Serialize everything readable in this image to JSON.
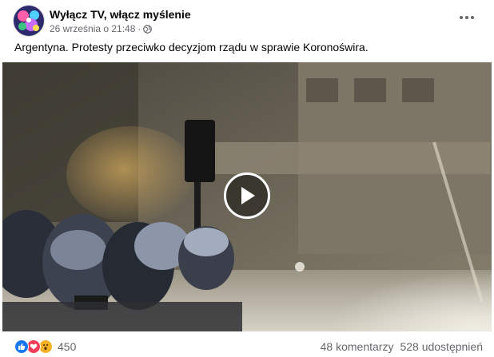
{
  "header": {
    "page_name": "Wyłącz TV, włącz myślenie",
    "timestamp": "26 września o 21:48",
    "separator": "·",
    "privacy_icon": "globe-icon",
    "more_icon": "more-options-icon"
  },
  "post": {
    "text": "Argentyna. Protesty przeciwko decyzjom rządu w sprawie Koronoświra."
  },
  "video": {
    "play_icon": "play-icon"
  },
  "footer": {
    "reaction_icons": [
      "like-icon",
      "love-icon",
      "wow-icon"
    ],
    "reaction_count": "450",
    "comments": "48 komentarzy",
    "shares": "528 udostępnień"
  },
  "colors": {
    "like": "#1877f2",
    "love": "#f33e58",
    "wow": "#f7b125",
    "secondary_text": "#65676b"
  }
}
